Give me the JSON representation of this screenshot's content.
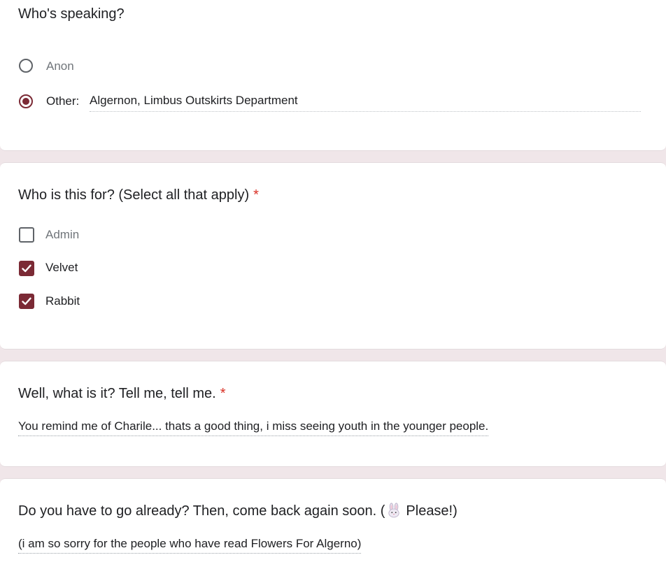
{
  "q1": {
    "title": "Who's speaking?",
    "options": [
      {
        "label": "Anon",
        "selected": false
      },
      {
        "label": "Other:",
        "selected": true
      }
    ],
    "other_value": "Algernon, Limbus Outskirts Department"
  },
  "q2": {
    "title": "Who is this for? (Select all that apply)",
    "required_mark": "*",
    "options": [
      {
        "label": "Admin",
        "checked": false
      },
      {
        "label": "Velvet",
        "checked": true
      },
      {
        "label": "Rabbit",
        "checked": true
      }
    ]
  },
  "q3": {
    "title": "Well, what is it? Tell me, tell me.",
    "required_mark": "*",
    "answer": "You remind me of Charile... thats a good thing, i miss seeing youth in the younger people."
  },
  "q4": {
    "title_before": "Do you have to go already? Then, come back again soon. (",
    "emoji_icon": "rabbit-face-icon",
    "title_after": "Please!)",
    "answer": "(i am so sorry for the people who have read Flowers For Algerno)"
  },
  "colors": {
    "accent": "#7b2a35",
    "background": "#f0e6e9",
    "required": "#d93025"
  }
}
